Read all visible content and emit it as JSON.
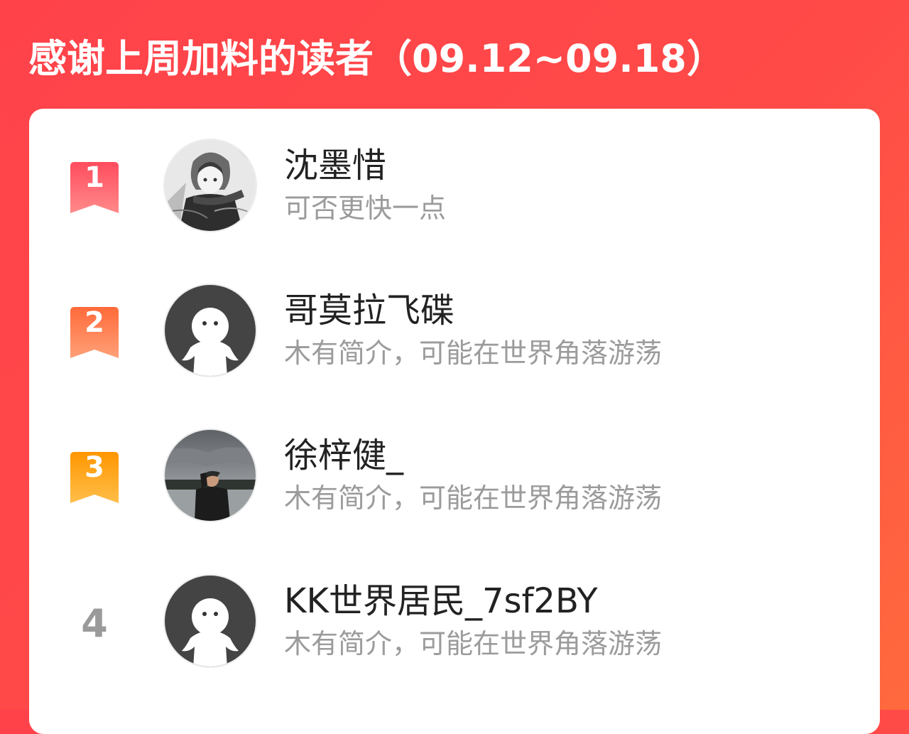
{
  "header": {
    "title": "感谢上周加料的读者（09.12~09.18）"
  },
  "colors": {
    "background": "#ff4848",
    "rank1": "#ff5b6a",
    "rank2": "#ff7b50",
    "rank3": "#ff9c1a",
    "rank_plain": "#9a9a9a",
    "name": "#222222",
    "desc": "#9b9b9b"
  },
  "readers": [
    {
      "rank": "1",
      "rank_icon": "ribbon-badge-red-icon",
      "avatar": "anime-character-avatar",
      "name": "沈墨惜",
      "desc": "可否更快一点"
    },
    {
      "rank": "2",
      "rank_icon": "ribbon-badge-orange-icon",
      "avatar": "default-ghost-avatar",
      "name": "哥莫拉飞碟",
      "desc": "木有简介，可能在世界角落游荡"
    },
    {
      "rank": "3",
      "rank_icon": "ribbon-badge-gold-icon",
      "avatar": "person-photo-avatar",
      "name": "徐梓健_",
      "desc": "木有简介，可能在世界角落游荡"
    },
    {
      "rank": "4",
      "rank_icon": "",
      "avatar": "default-ghost-avatar",
      "name": "KK世界居民_7sf2BY",
      "desc": "木有简介，可能在世界角落游荡"
    }
  ]
}
